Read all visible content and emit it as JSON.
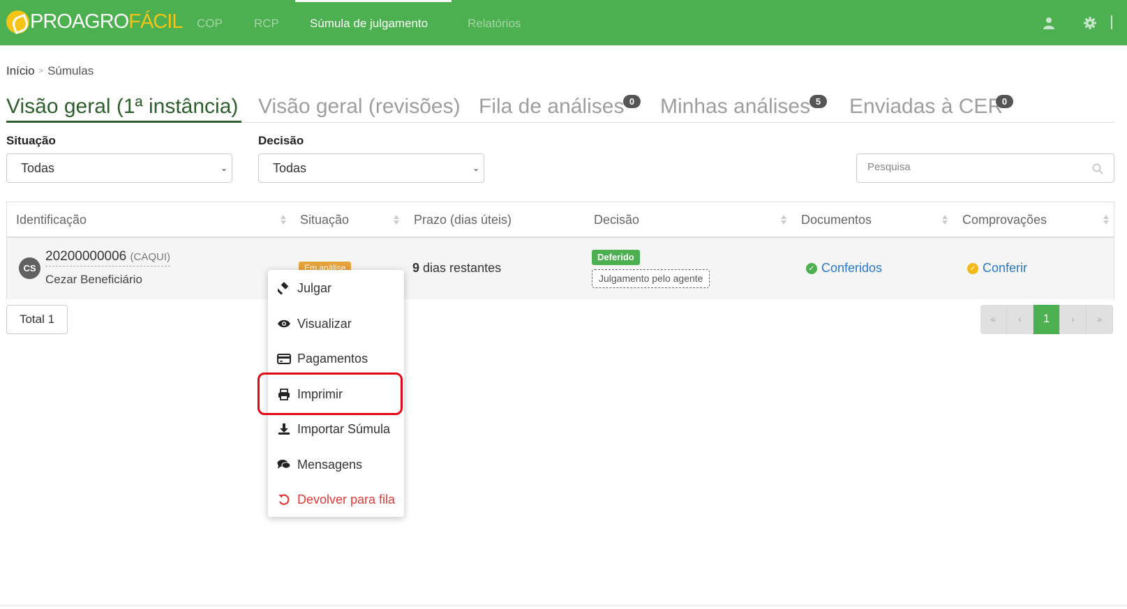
{
  "app": {
    "logo_part1": "PROAGRO",
    "logo_part2": "FÁCIL"
  },
  "nav": {
    "items": [
      {
        "label": "COP"
      },
      {
        "label": "RCP"
      },
      {
        "label": "Súmula de julgamento"
      },
      {
        "label": "Relatórios"
      }
    ]
  },
  "breadcrumb": {
    "home": "Início",
    "separator": ">",
    "current": "Súmulas"
  },
  "tabs": [
    {
      "label": "Visão geral (1ª instância)"
    },
    {
      "label": "Visão geral (revisões)"
    },
    {
      "label": "Fila de análises",
      "badge": "0"
    },
    {
      "label": "Minhas análises",
      "badge": "5"
    },
    {
      "label": "Enviadas à CER",
      "badge": "0"
    }
  ],
  "filters": {
    "situacao_label": "Situação",
    "situacao_value": "Todas",
    "decisao_label": "Decisão",
    "decisao_value": "Todas",
    "search_placeholder": "Pesquisa"
  },
  "table": {
    "headers": [
      "Identificação",
      "Situação",
      "Prazo (dias úteis)",
      "Decisão",
      "Documentos",
      "Comprovações"
    ],
    "rows": [
      {
        "avatar": "CS",
        "id": "20200000006",
        "code": "(CAQUI)",
        "name": "Cezar Beneficiário",
        "status": "Em análise",
        "prazo_num": "9",
        "prazo_text": "dias restantes",
        "decision": "Deferido",
        "decision_note": "Julgamento pelo agente",
        "documentos": "Conferidos",
        "comprovacoes": "Conferir"
      }
    ]
  },
  "total": "Total 1",
  "pager": {
    "first": "«",
    "prev": "‹",
    "current": "1",
    "next": "›",
    "last": "»"
  },
  "menu": {
    "items": [
      {
        "label": "Julgar",
        "icon": "gavel-icon"
      },
      {
        "label": "Visualizar",
        "icon": "eye-icon"
      },
      {
        "label": "Pagamentos",
        "icon": "credit-card-icon"
      },
      {
        "label": "Imprimir",
        "icon": "print-icon"
      },
      {
        "label": "Importar Súmula",
        "icon": "download-icon"
      },
      {
        "label": "Mensagens",
        "icon": "comments-icon"
      },
      {
        "label": "Devolver para fila",
        "icon": "undo-icon"
      }
    ]
  },
  "colors": {
    "brand_green": "#4caf50",
    "brand_yellow": "#f6c417",
    "danger": "#e53935",
    "highlight_red": "#e30613",
    "warning": "#e6a23c",
    "link": "#2979c7"
  }
}
